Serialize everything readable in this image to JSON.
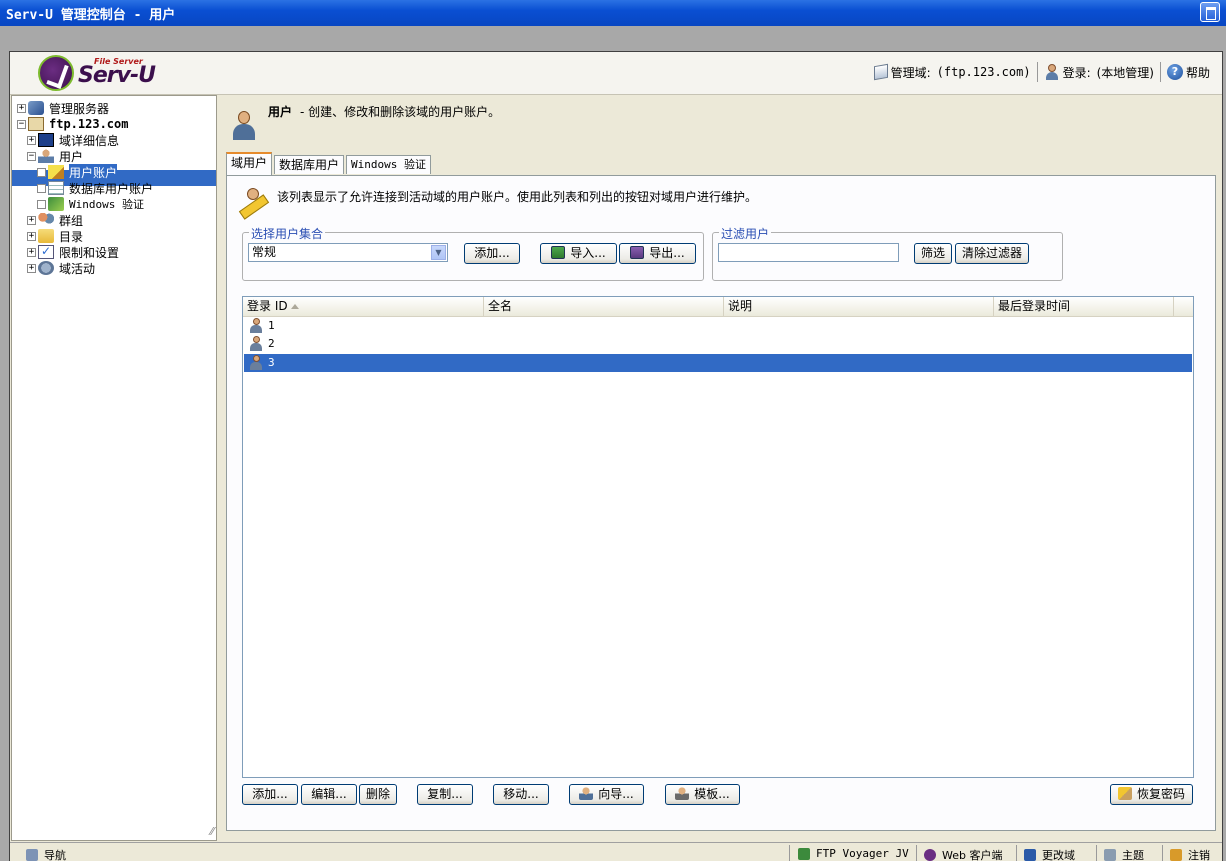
{
  "window": {
    "title": "Serv-U 管理控制台 - 用户"
  },
  "header": {
    "logo_small": "File Server",
    "logo_name": "Serv-U",
    "domain_label": "管理域:",
    "domain_value": "(ftp.123.com)",
    "login_label": "登录:",
    "login_value": "(本地管理)",
    "help_label": "帮助"
  },
  "tree": {
    "items": [
      {
        "label": "管理服务器",
        "icon": "server-icon"
      },
      {
        "label": "ftp.123.com",
        "icon": "home-icon"
      },
      {
        "label": "域详细信息",
        "icon": "monitor-icon"
      },
      {
        "label": "用户",
        "icon": "user-icon"
      },
      {
        "label": "用户账户",
        "icon": "pencil-icon"
      },
      {
        "label": "数据库用户账户",
        "icon": "database-grid-icon"
      },
      {
        "label": "Windows 验证",
        "icon": "windows-key-icon"
      },
      {
        "label": "群组",
        "icon": "group-icon"
      },
      {
        "label": "目录",
        "icon": "folder-icon"
      },
      {
        "label": "限制和设置",
        "icon": "checklist-icon"
      },
      {
        "label": "域活动",
        "icon": "activity-icon"
      }
    ]
  },
  "page": {
    "title": "用户",
    "subtitle": "- 创建、修改和删除该域的用户账户。",
    "tabs": [
      "域用户",
      "数据库用户",
      "Windows 验证"
    ],
    "description": "该列表显示了允许连接到活动域的用户账户。使用此列表和列出的按钮对域用户进行维护。"
  },
  "collection": {
    "legend": "选择用户集合",
    "selected": "常规",
    "add_label": "添加...",
    "import_label": "导入...",
    "export_label": "导出..."
  },
  "filter": {
    "legend": "过滤用户",
    "value": "",
    "filter_label": "筛选",
    "clear_label": "清除过滤器"
  },
  "users_table": {
    "columns": [
      "登录 ID",
      "全名",
      "说明",
      "最后登录时间"
    ],
    "rows": [
      {
        "id": "1",
        "full_name": "",
        "description": "",
        "last_login": ""
      },
      {
        "id": "2",
        "full_name": "",
        "description": "",
        "last_login": ""
      },
      {
        "id": "3",
        "full_name": "",
        "description": "",
        "last_login": ""
      }
    ],
    "selected_row": "3"
  },
  "actions": {
    "add": "添加...",
    "edit": "编辑...",
    "delete": "删除",
    "copy": "复制...",
    "move": "移动...",
    "wizard": "向导...",
    "template": "模板...",
    "recover_password": "恢复密码"
  },
  "statusbar": {
    "nav": "导航",
    "items": [
      "FTP Voyager JV",
      "Web 客户端",
      "更改域",
      "主题",
      "注销"
    ]
  }
}
